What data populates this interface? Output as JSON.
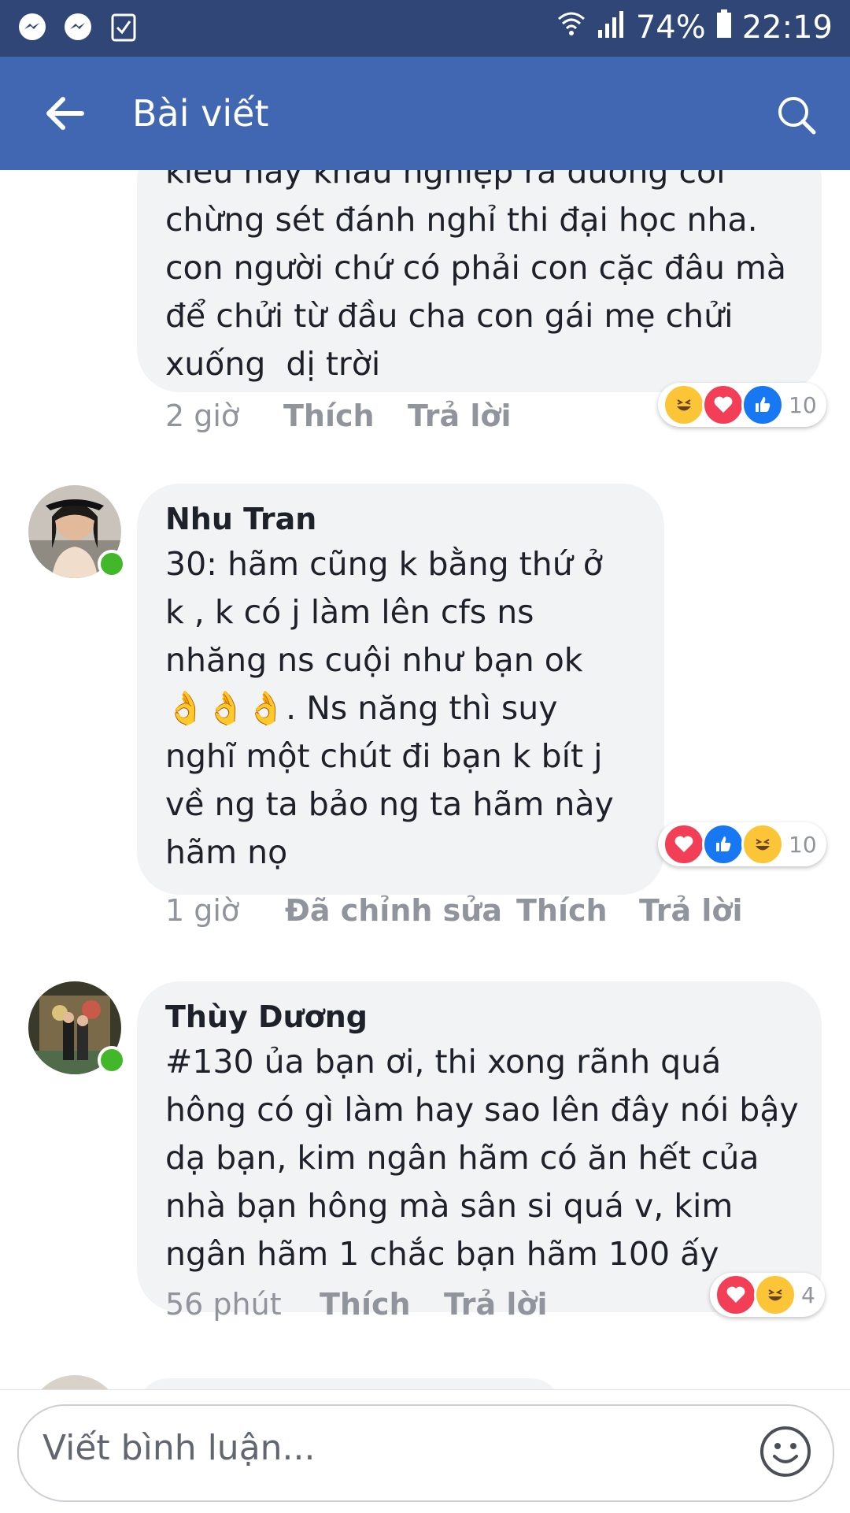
{
  "status_bar": {
    "battery": "74%",
    "time": "22:19"
  },
  "app_bar": {
    "title": "Bài viết"
  },
  "comments": [
    {
      "text_lines": [
        "kiểu hay khẩu nghiệp ra đường coi",
        "chừng sét đánh nghỉ thi đại học nha.",
        "con người chứ có phải con cặc đâu mà",
        "để chửi từ đầu cha con gái mẹ chửi",
        "xuống  dị trời"
      ],
      "time": "2 giờ",
      "like": "Thích",
      "reply": "Trả lời",
      "reaction_icons": [
        "haha",
        "love",
        "like"
      ],
      "reaction_count": "10"
    },
    {
      "name": "Nhu Tran",
      "text_lines": [
        "30: hãm cũng k bằng thứ ở",
        "k , k có j làm lên cfs ns",
        "nhăng ns cuội như bạn ok",
        "👌👌👌. Ns năng thì suy",
        "nghĩ một chút đi bạn k bít j",
        "về ng ta bảo ng ta hãm này",
        "hãm nọ"
      ],
      "time": "1 giờ",
      "edited": "Đã chỉnh sửa",
      "like": "Thích",
      "reply": "Trả lời",
      "reaction_icons": [
        "love",
        "like",
        "haha"
      ],
      "reaction_count": "10"
    },
    {
      "name": "Thùy Dương",
      "text_lines": [
        "#130 ủa bạn ơi, thi xong rãnh quá",
        "hông có gì làm hay sao lên đây nói bậy",
        "dạ bạn, kim ngân hãm có ăn hết của",
        "nhà bạn hông mà sân si quá v, kim",
        "ngân hãm 1 chắc bạn hãm 100 ấy"
      ],
      "time": "56 phút",
      "like": "Thích",
      "reply": "Trả lời",
      "reaction_icons": [
        "love",
        "haha"
      ],
      "reaction_count": "4"
    }
  ],
  "composer": {
    "placeholder": "Viết bình luận..."
  }
}
